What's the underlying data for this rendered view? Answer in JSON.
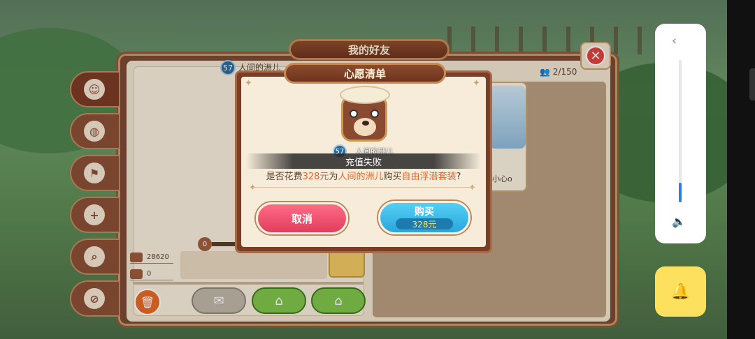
{
  "main_panel": {
    "title": "我的好友",
    "close_icon": "close-icon",
    "friend_count": "2/150",
    "player": {
      "level": "57",
      "name": "人间的洲儿"
    },
    "friend_card": {
      "name": "小心o"
    },
    "stats": {
      "likes": "28620",
      "comments": "0"
    },
    "progress_value": "0",
    "tabs": [
      "face-icon",
      "ball-icon",
      "flag-icon",
      "add-friend-icon",
      "search-icon",
      "block-icon"
    ]
  },
  "wishlist_dialog": {
    "title": "心愿清单",
    "avatar_level": "57",
    "avatar_name": "人间的洲儿",
    "toast": "充值失败",
    "question": {
      "prefix": "是否花费",
      "price": "328元",
      "for": "为",
      "recipient": "人间的洲儿",
      "buy": "购买",
      "item": "自由浮潜套装",
      "suffix": "?"
    },
    "cancel_label": "取消",
    "buy_label": "购买",
    "buy_price": "328元"
  },
  "system": {
    "volume_level": 0.12,
    "colors": {
      "accent": "#3a78e0",
      "bell": "#fde05e"
    }
  }
}
